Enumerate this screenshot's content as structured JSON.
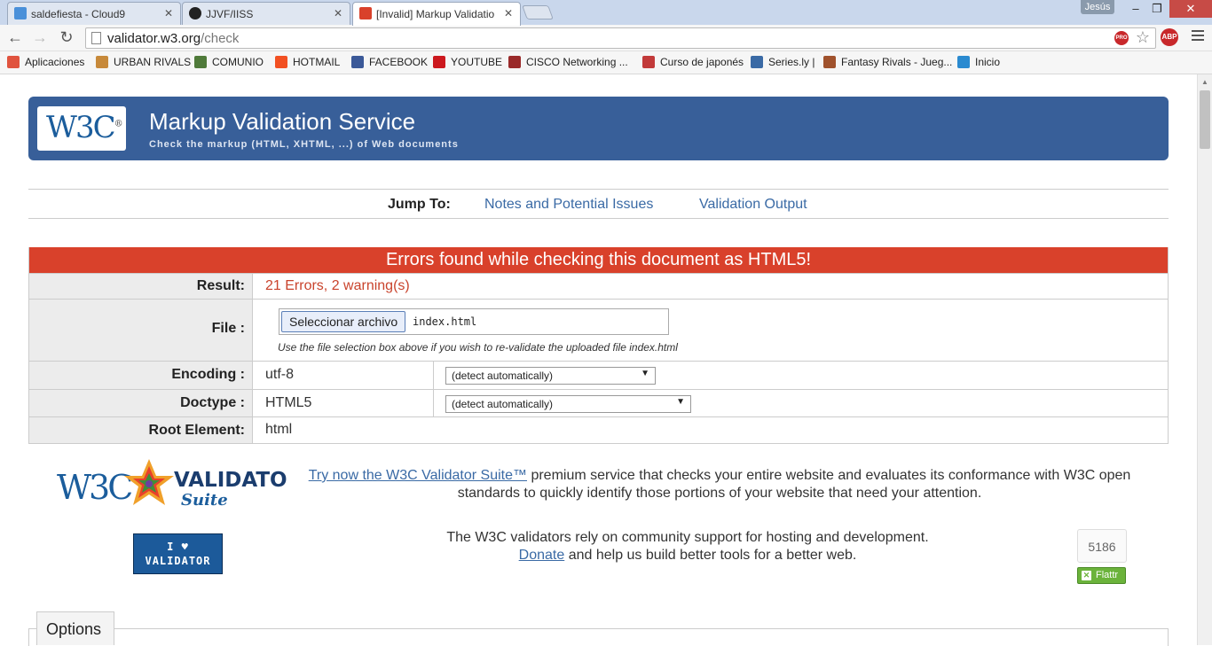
{
  "browser": {
    "tabs": [
      {
        "title": "saldefiesta - Cloud9",
        "color": "#4a90d9"
      },
      {
        "title": "JJVF/IISS",
        "color": "#222222"
      },
      {
        "title": "[Invalid] Markup Validatio",
        "color": "#d9412b"
      }
    ],
    "user": "Jesús",
    "url_host": "validator.w3.org",
    "url_path": "/check"
  },
  "bookmarks": [
    {
      "label": "Aplicaciones",
      "color": "#e0533e"
    },
    {
      "label": "URBAN RIVALS",
      "color": "#c7893a"
    },
    {
      "label": "COMUNIO",
      "color": "#4f7a3a"
    },
    {
      "label": "HOTMAIL",
      "color": "#f25022"
    },
    {
      "label": "FACEBOOK",
      "color": "#3b5998"
    },
    {
      "label": "YOUTUBE",
      "color": "#cc181e"
    },
    {
      "label": "CISCO Networking ...",
      "color": "#9a2a2a"
    },
    {
      "label": "Curso de japonés",
      "color": "#c23a3a"
    },
    {
      "label": "Series.ly |",
      "color": "#3a6aa5"
    },
    {
      "label": "Fantasy Rivals - Jueg...",
      "color": "#a0522d"
    },
    {
      "label": "Inicio",
      "color": "#2a8ad0"
    }
  ],
  "banner": {
    "logo": "W3C",
    "title": "Markup Validation Service",
    "subtitle": "Check the markup (HTML, XHTML, ...) of Web documents"
  },
  "jump": {
    "label": "Jump To:",
    "links": [
      "Notes and Potential Issues",
      "Validation Output"
    ]
  },
  "result": {
    "banner": "Errors found while checking this document as HTML5!",
    "result_label": "Result:",
    "result_value": "21 Errors, 2 warning(s)",
    "file_label": "File :",
    "file_button": "Seleccionar archivo",
    "file_name": "index.html",
    "file_hint": "Use the file selection box above if you wish to re-validate the uploaded file index.html",
    "encoding_label": "Encoding :",
    "encoding_value": "utf-8",
    "encoding_select": "(detect automatically)",
    "doctype_label": "Doctype :",
    "doctype_value": "HTML5",
    "doctype_select": "(detect automatically)",
    "root_label": "Root Element:",
    "root_value": "html"
  },
  "promo": {
    "suite_link": "Try now the W3C Validator Suite™",
    "suite_rest": " premium service that checks your entire website and evaluates its conformance with W3C open standards to quickly identify those portions of your website that need your attention.",
    "badge_line1": "I ♥",
    "badge_line2": "VALIDATOR",
    "support_text": "The W3C validators rely on community support for hosting and development.",
    "donate_link": "Donate",
    "donate_rest": " and help us build better tools for a better web.",
    "flattr_count": "5186",
    "flattr_label": "Flattr"
  },
  "options": {
    "label": "Options"
  }
}
